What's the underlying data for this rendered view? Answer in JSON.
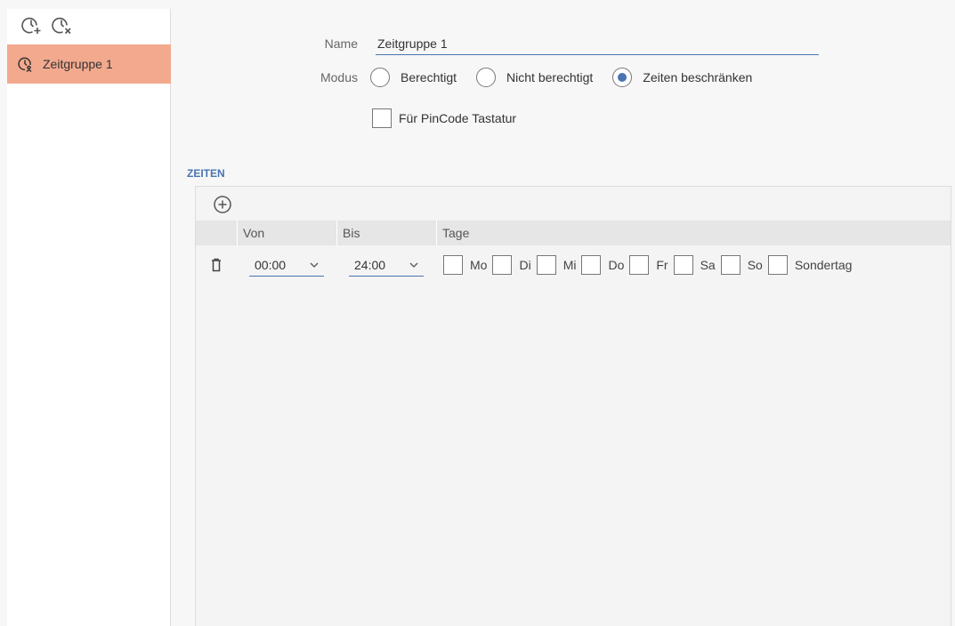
{
  "sidebar": {
    "toolbar": [
      {
        "icon": "clock-add-icon"
      },
      {
        "icon": "clock-remove-icon"
      }
    ],
    "items": [
      {
        "label": "Zeitgruppe 1",
        "icon": "clock-group-icon",
        "selected": true
      }
    ]
  },
  "form": {
    "name_label": "Name",
    "name_value": "Zeitgruppe 1",
    "mode_label": "Modus",
    "modes": [
      {
        "label": "Berechtigt",
        "checked": false
      },
      {
        "label": "Nicht berechtigt",
        "checked": false
      },
      {
        "label": "Zeiten beschränken",
        "checked": true
      }
    ],
    "pincode_label": "Für PinCode Tastatur",
    "pincode_checked": false
  },
  "times": {
    "section_title": "ZEITEN",
    "columns": [
      "Von",
      "Bis",
      "Tage"
    ],
    "rows": [
      {
        "from": "00:00",
        "to": "24:00",
        "days": [
          {
            "label": "Mo",
            "checked": false
          },
          {
            "label": "Di",
            "checked": false
          },
          {
            "label": "Mi",
            "checked": false
          },
          {
            "label": "Do",
            "checked": false
          },
          {
            "label": "Fr",
            "checked": false
          },
          {
            "label": "Sa",
            "checked": false
          },
          {
            "label": "So",
            "checked": false
          },
          {
            "label": "Sondertag",
            "checked": false
          }
        ]
      }
    ]
  },
  "colors": {
    "accent": "#4a74b0",
    "selection": "#f2a98e",
    "icon": "#555555"
  }
}
